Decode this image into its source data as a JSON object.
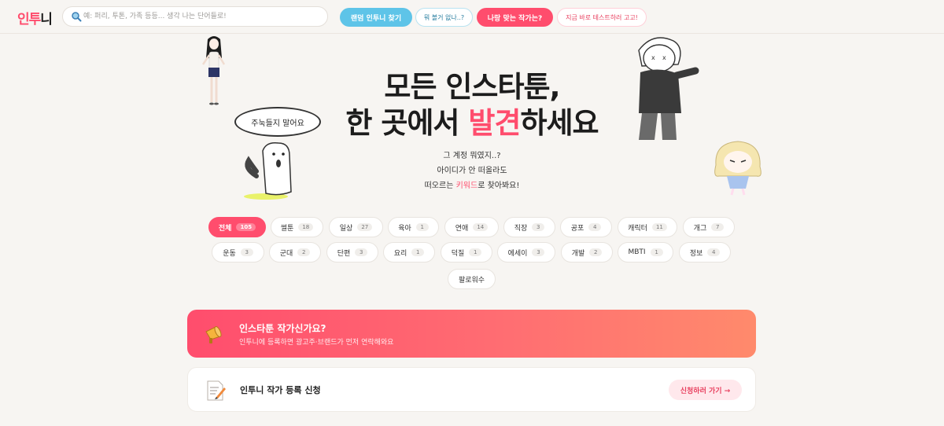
{
  "header": {
    "logo_part1": "인투",
    "logo_part2": "니",
    "search_placeholder": "예: 퍼리, 투톤, 가족 등등... 생각 나는 단어들로!",
    "random_button": "랜덤 인투니 찾기",
    "random_hint": "뭐 볼거 없나..?",
    "match_button": "나랑 맞는 작가는?",
    "match_hint": "지금 바로 테스트하러 고고!"
  },
  "hero": {
    "title_line1": "모든 인스타툰,",
    "title_line2_pre": "한 곳에서 ",
    "title_line2_hl": "발견",
    "title_line2_post": "하세요",
    "desc_line1": "그 계정 뭐였지..?",
    "desc_line2": "아이디가 안 떠올라도",
    "desc_line3_pre": "떠오르는 ",
    "desc_line3_kw": "키워드",
    "desc_line3_post": "로 찾아봐요!",
    "bubble_text": "주눅들지 말어요"
  },
  "categories": [
    {
      "label": "전체",
      "count": "105"
    },
    {
      "label": "썰툰",
      "count": "18"
    },
    {
      "label": "일상",
      "count": "27"
    },
    {
      "label": "육아",
      "count": "1"
    },
    {
      "label": "연애",
      "count": "14"
    },
    {
      "label": "직장",
      "count": "3"
    },
    {
      "label": "공포",
      "count": "4"
    },
    {
      "label": "캐릭터",
      "count": "11"
    },
    {
      "label": "개그",
      "count": "7"
    },
    {
      "label": "운동",
      "count": "3"
    },
    {
      "label": "군대",
      "count": "2"
    },
    {
      "label": "단편",
      "count": "3"
    },
    {
      "label": "요리",
      "count": "1"
    },
    {
      "label": "덕질",
      "count": "1"
    },
    {
      "label": "에세이",
      "count": "3"
    },
    {
      "label": "개발",
      "count": "2"
    },
    {
      "label": "MBTI",
      "count": "1"
    },
    {
      "label": "정보",
      "count": "4"
    },
    {
      "label": "팔로워수",
      "count": ""
    }
  ],
  "promo": {
    "title": "인스타툰 작가신가요?",
    "subtitle": "인투니에 등록하면 광고주·브랜드가 먼저 연락해와요"
  },
  "register": {
    "title": "인투니 작가 등록 신청",
    "cta": "신청하러 가기 →"
  },
  "icons": [
    "search-icon",
    "megaphone-icon",
    "memo-icon"
  ],
  "colors": {
    "accent": "#ff4d6d",
    "blue": "#5ec4e8",
    "background": "#f7f5f2"
  }
}
